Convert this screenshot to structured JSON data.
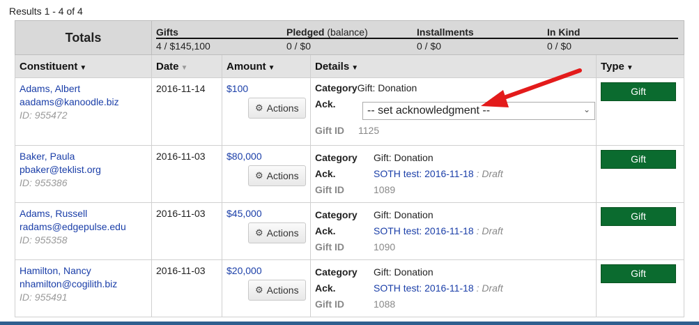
{
  "results_text": "Results 1 - 4 of 4",
  "totals": {
    "label": "Totals",
    "columns": [
      {
        "title": "Gifts",
        "suffix": "",
        "value": "4 / $145,100"
      },
      {
        "title": "Pledged",
        "suffix": "(balance)",
        "value": "0 / $0"
      },
      {
        "title": "Installments",
        "suffix": "",
        "value": "0 / $0"
      },
      {
        "title": "In Kind",
        "suffix": "",
        "value": "0 / $0"
      }
    ]
  },
  "headers": {
    "constituent": "Constituent",
    "date": "Date",
    "amount": "Amount",
    "details": "Details",
    "type": "Type"
  },
  "detail_labels": {
    "category": "Category",
    "ack": "Ack.",
    "gift_id": "Gift ID"
  },
  "actions_label": "Actions",
  "rows": [
    {
      "name": "Adams, Albert",
      "email": "aadams@kanoodle.biz",
      "id": "ID: 955472",
      "date": "2016-11-14",
      "amount": "$100",
      "category": "Gift: Donation",
      "ack_select": "-- set acknowledgment --",
      "gift_id": "1125",
      "type": "Gift"
    },
    {
      "name": "Baker, Paula",
      "email": "pbaker@teklist.org",
      "id": "ID: 955386",
      "date": "2016-11-03",
      "amount": "$80,000",
      "category": "Gift: Donation",
      "ack_link": "SOTH test: 2016-11-18",
      "ack_status": ": Draft",
      "gift_id": "1089",
      "type": "Gift"
    },
    {
      "name": "Adams, Russell",
      "email": "radams@edgepulse.edu",
      "id": "ID: 955358",
      "date": "2016-11-03",
      "amount": "$45,000",
      "category": "Gift: Donation",
      "ack_link": "SOTH test: 2016-11-18",
      "ack_status": ": Draft",
      "gift_id": "1090",
      "type": "Gift"
    },
    {
      "name": "Hamilton, Nancy",
      "email": "nhamilton@cogilith.biz",
      "id": "ID: 955491",
      "date": "2016-11-03",
      "amount": "$20,000",
      "category": "Gift: Donation",
      "ack_link": "SOTH test: 2016-11-18",
      "ack_status": ": Draft",
      "gift_id": "1088",
      "type": "Gift"
    }
  ],
  "colors": {
    "gift_button": "#0b6b2f",
    "link": "#1a3ea8",
    "annotation_arrow": "#e31b1b"
  }
}
